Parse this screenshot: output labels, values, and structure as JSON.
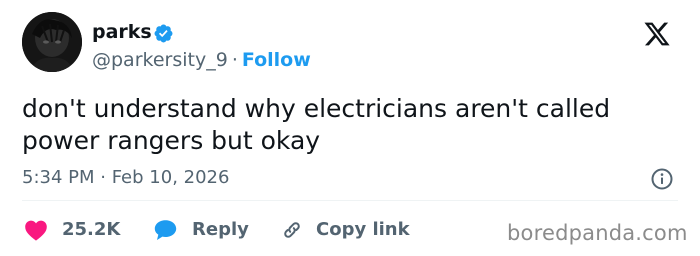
{
  "author": {
    "display_name": "parks",
    "handle": "@parkersity_9",
    "separator": "·",
    "follow_label": "Follow",
    "verified": true
  },
  "tweet": {
    "text": "don't understand why electricians aren't called power rangers but okay",
    "timestamp": "5:34 PM · Feb 10, 2026"
  },
  "actions": {
    "like_count": "25.2K",
    "reply_label": "Reply",
    "copy_link_label": "Copy link"
  },
  "icons": {
    "brand": "x-logo-icon",
    "verified": "verified-badge-icon",
    "info": "info-icon",
    "like": "heart-icon",
    "reply": "speech-bubble-icon",
    "copy_link": "link-icon"
  },
  "colors": {
    "text": "#0f1419",
    "secondary": "#536471",
    "accent": "#1d9bf0",
    "like": "#f91880",
    "watermark": "#8b8b8b"
  },
  "watermark": "boredpanda.com"
}
